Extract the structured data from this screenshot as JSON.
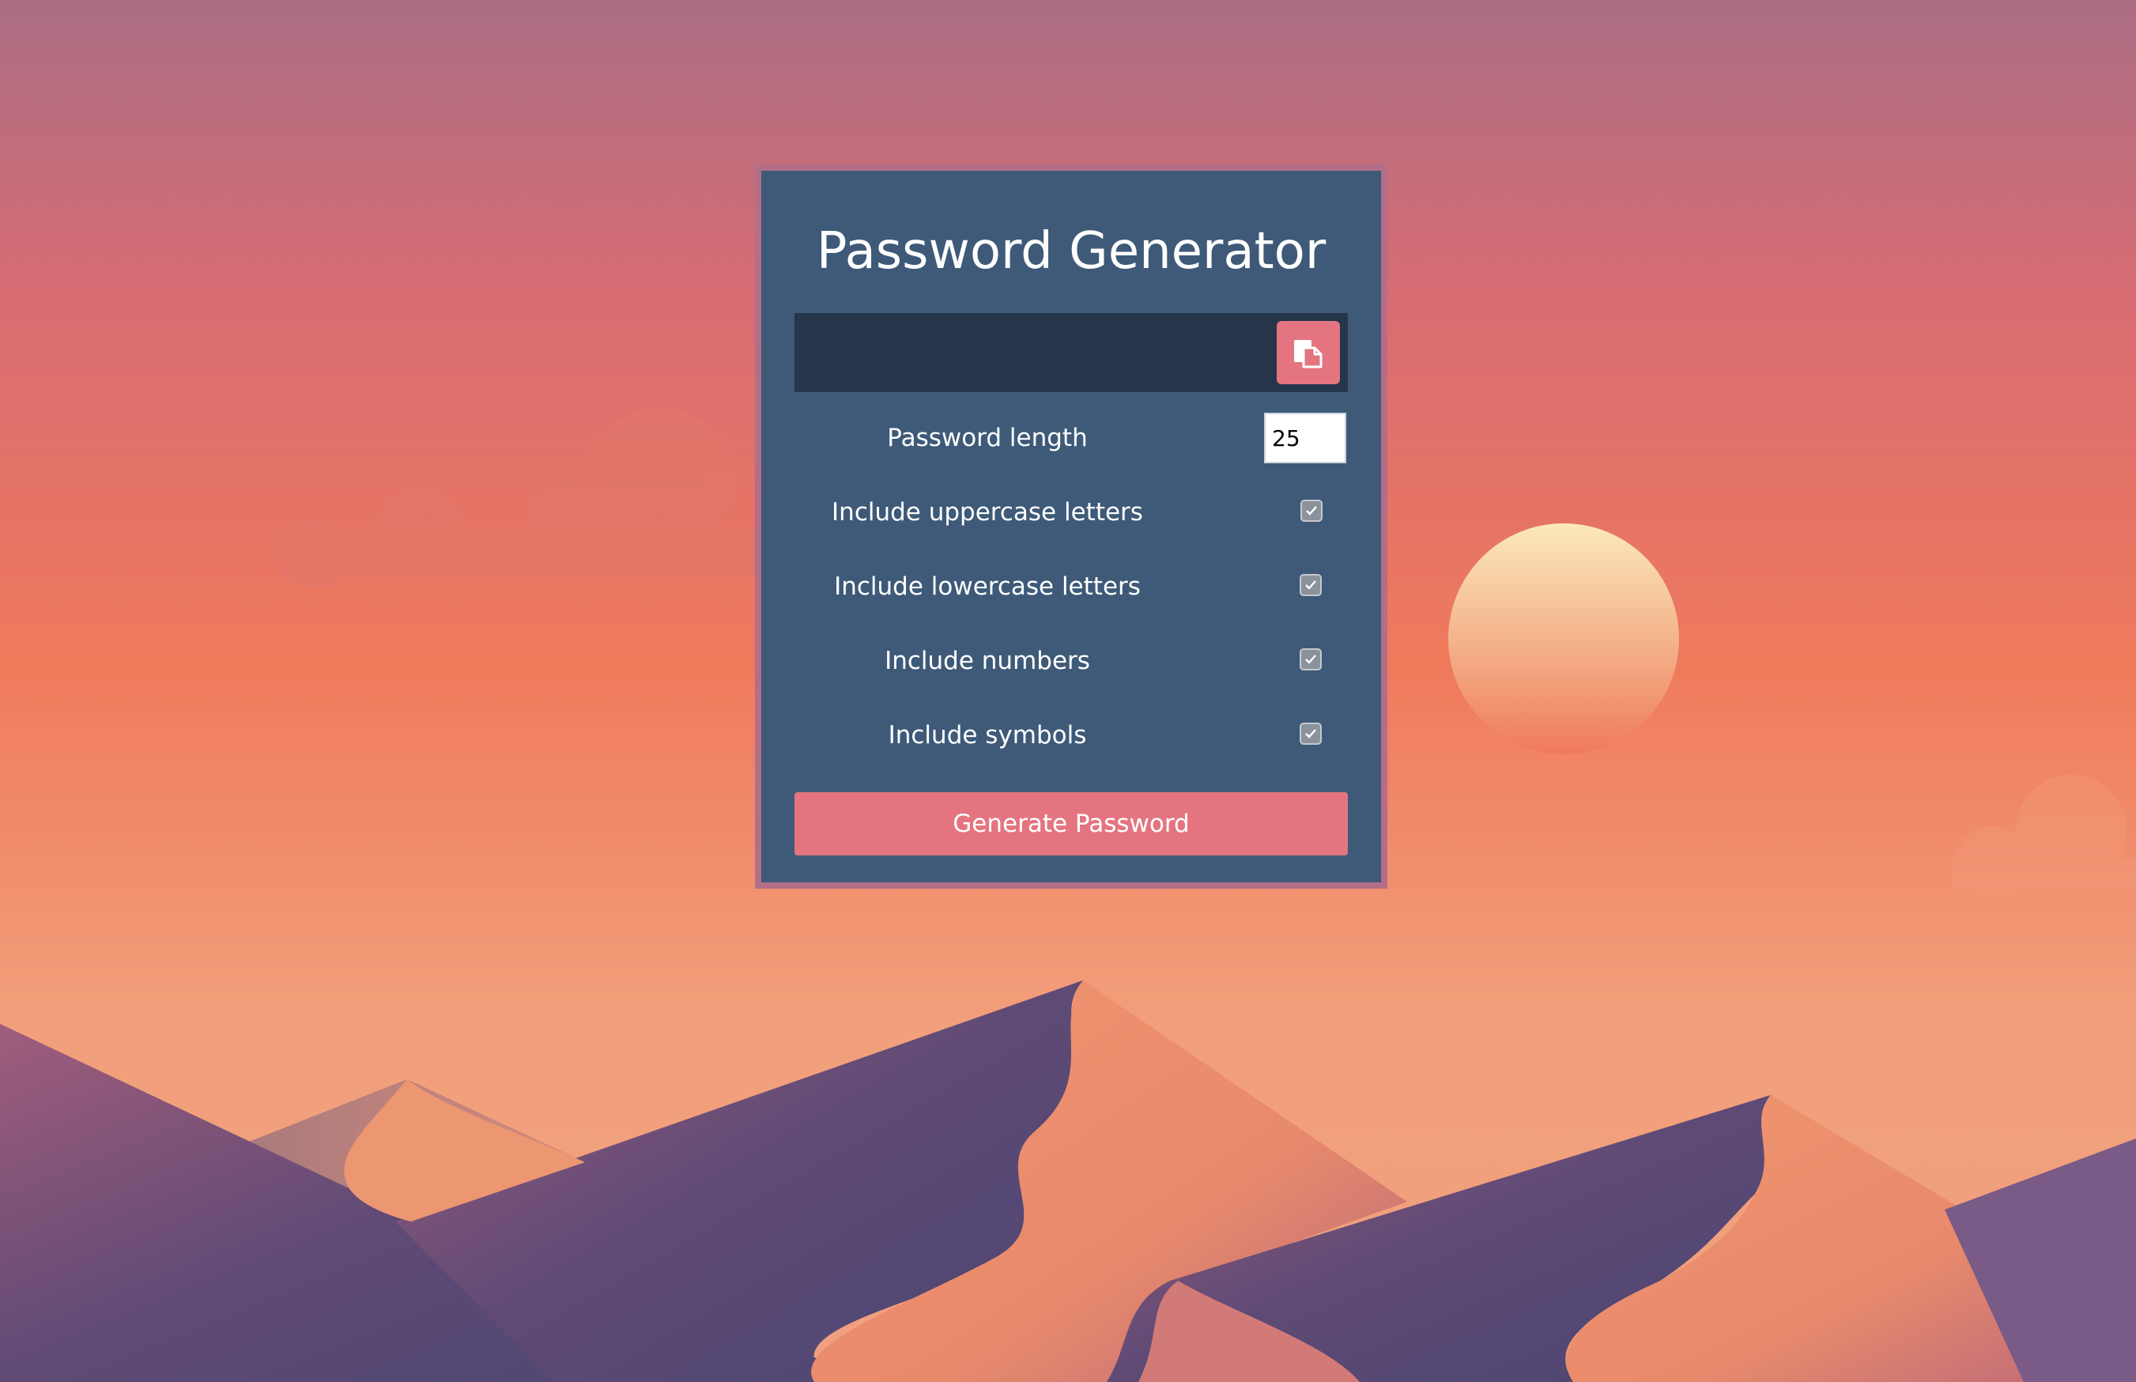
{
  "app": {
    "title": "Password Generator"
  },
  "result": {
    "value": "",
    "copy_icon": "clipboard-copy-icon"
  },
  "settings": {
    "length": {
      "label": "Password length",
      "value": "25"
    },
    "options": [
      {
        "label": "Include uppercase letters",
        "checked": true
      },
      {
        "label": "Include lowercase letters",
        "checked": true
      },
      {
        "label": "Include numbers",
        "checked": true
      },
      {
        "label": "Include symbols",
        "checked": true
      }
    ]
  },
  "actions": {
    "generate_label": "Generate Password"
  },
  "colors": {
    "card_bg": "#3e5a78",
    "card_border": "#b46e88",
    "result_bg": "#25364a",
    "accent": "#e47580",
    "text": "#ffffff"
  }
}
